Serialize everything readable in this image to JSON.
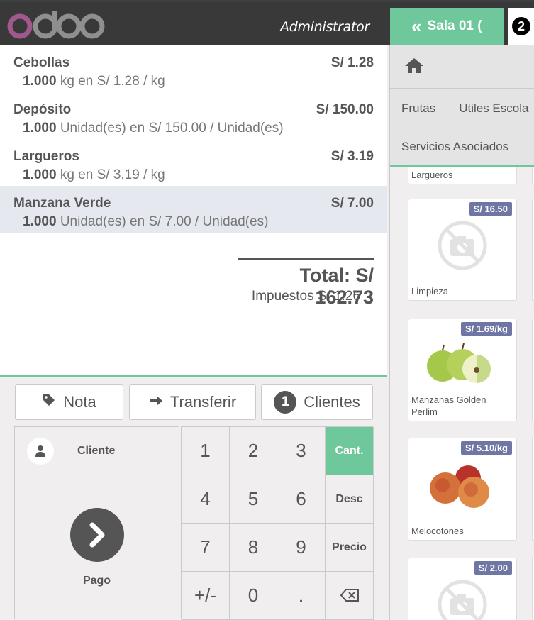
{
  "header": {
    "logo_text": "odoo",
    "user": "Administrator",
    "tab_label": "Sala 01 (",
    "tab_order_number": "2"
  },
  "orderlines": [
    {
      "name": "Cebollas",
      "price": "S/ 1.28",
      "qty": "1.000",
      "info": " kg en S/ 1.28 / kg"
    },
    {
      "name": "Depósito",
      "price": "S/ 150.00",
      "qty": "1.000",
      "info": " Unidad(es) en S/ 150.00 / Unidad(es)"
    },
    {
      "name": "Largueros",
      "price": "S/ 3.19",
      "qty": "1.000",
      "info": " kg en S/ 3.19 / kg"
    },
    {
      "name": "Manzana Verde",
      "price": "S/ 7.00",
      "qty": "1.000",
      "info": " Unidad(es) en S/ 7.00 / Unidad(es)"
    }
  ],
  "summary": {
    "total": "Total: S/ 162.73",
    "taxes": "Impuestos S/ 1.26"
  },
  "controls": {
    "note": "Nota",
    "transfer": "Transferir",
    "clients_count": "1",
    "clients": "Clientes"
  },
  "actionpad": {
    "customer": "Cliente",
    "payment": "Pago"
  },
  "numpad": {
    "keys": [
      "1",
      "2",
      "3",
      "Cant.",
      "4",
      "5",
      "6",
      "Desc",
      "7",
      "8",
      "9",
      "Precio",
      "+/-",
      "0",
      ".",
      "⌫"
    ],
    "active_mode": "Cant."
  },
  "categories": {
    "row1": [
      "Frutas",
      "Utiles Escola"
    ],
    "row2": [
      "Servicios Asociados"
    ]
  },
  "products": [
    {
      "name": "Largueros",
      "price": ""
    },
    {
      "name": "Limpieza",
      "price": "S/ 16.50"
    },
    {
      "name": "Manzanas Golden Perlim",
      "price": "S/ 1.69/kg"
    },
    {
      "name": "Melocotones",
      "price": "S/ 5.10/kg"
    },
    {
      "name": "",
      "price": "S/ 2.00"
    }
  ],
  "colors": {
    "accent": "#6ec89b",
    "header": "#393939",
    "badge": "#7076a3",
    "selected_line": "#e6e8ef"
  }
}
